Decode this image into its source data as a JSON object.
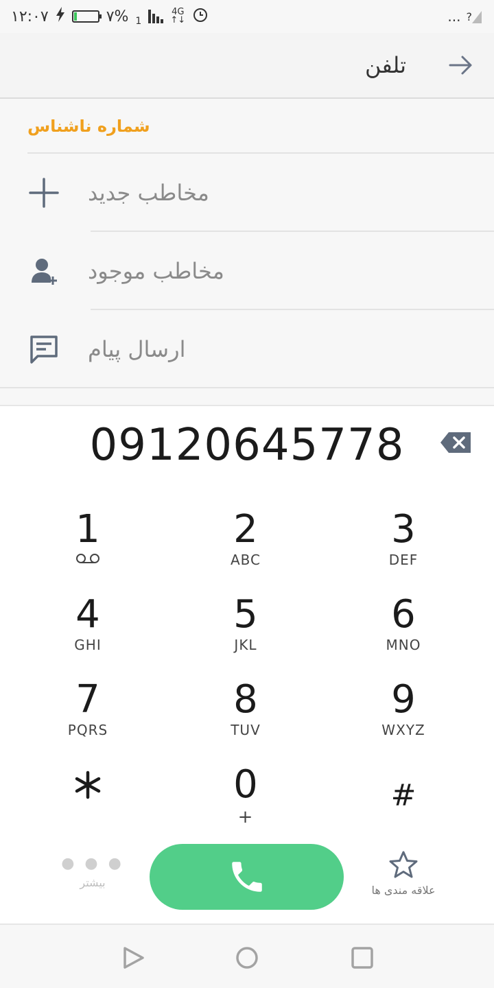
{
  "status_bar": {
    "time": "۱۲:۰۷",
    "battery_percent": "۷%",
    "battery_level": 0.12,
    "network": "4G",
    "sim_slot": "1",
    "more": "...",
    "signal_unknown": "?"
  },
  "app_bar": {
    "title": "تلفن",
    "back_icon": "arrow-icon"
  },
  "unknown_number": {
    "label": "شماره ناشناس"
  },
  "actions": [
    {
      "label": "مخاطب جدید",
      "icon": "plus-icon"
    },
    {
      "label": "مخاطب موجود",
      "icon": "add-person-icon"
    },
    {
      "label": "ارسال پیام",
      "icon": "message-icon"
    }
  ],
  "dialer": {
    "number": "09120645778",
    "keys": [
      {
        "digit": "1",
        "letters": ""
      },
      {
        "digit": "2",
        "letters": "ABC"
      },
      {
        "digit": "3",
        "letters": "DEF"
      },
      {
        "digit": "4",
        "letters": "GHI"
      },
      {
        "digit": "5",
        "letters": "JKL"
      },
      {
        "digit": "6",
        "letters": "MNO"
      },
      {
        "digit": "7",
        "letters": "PQRS"
      },
      {
        "digit": "8",
        "letters": "TUV"
      },
      {
        "digit": "9",
        "letters": "WXYZ"
      },
      {
        "digit": "*",
        "letters": ""
      },
      {
        "digit": "0",
        "letters": "+"
      },
      {
        "digit": "#",
        "letters": ""
      }
    ],
    "more_label": "بیشتر",
    "favorites_label": "علاقه مندی ها",
    "call_color": "#52ce89"
  },
  "colors": {
    "accent_orange": "#f0a01e",
    "call_green": "#52ce89",
    "icon_slate": "#5f6b7c"
  }
}
